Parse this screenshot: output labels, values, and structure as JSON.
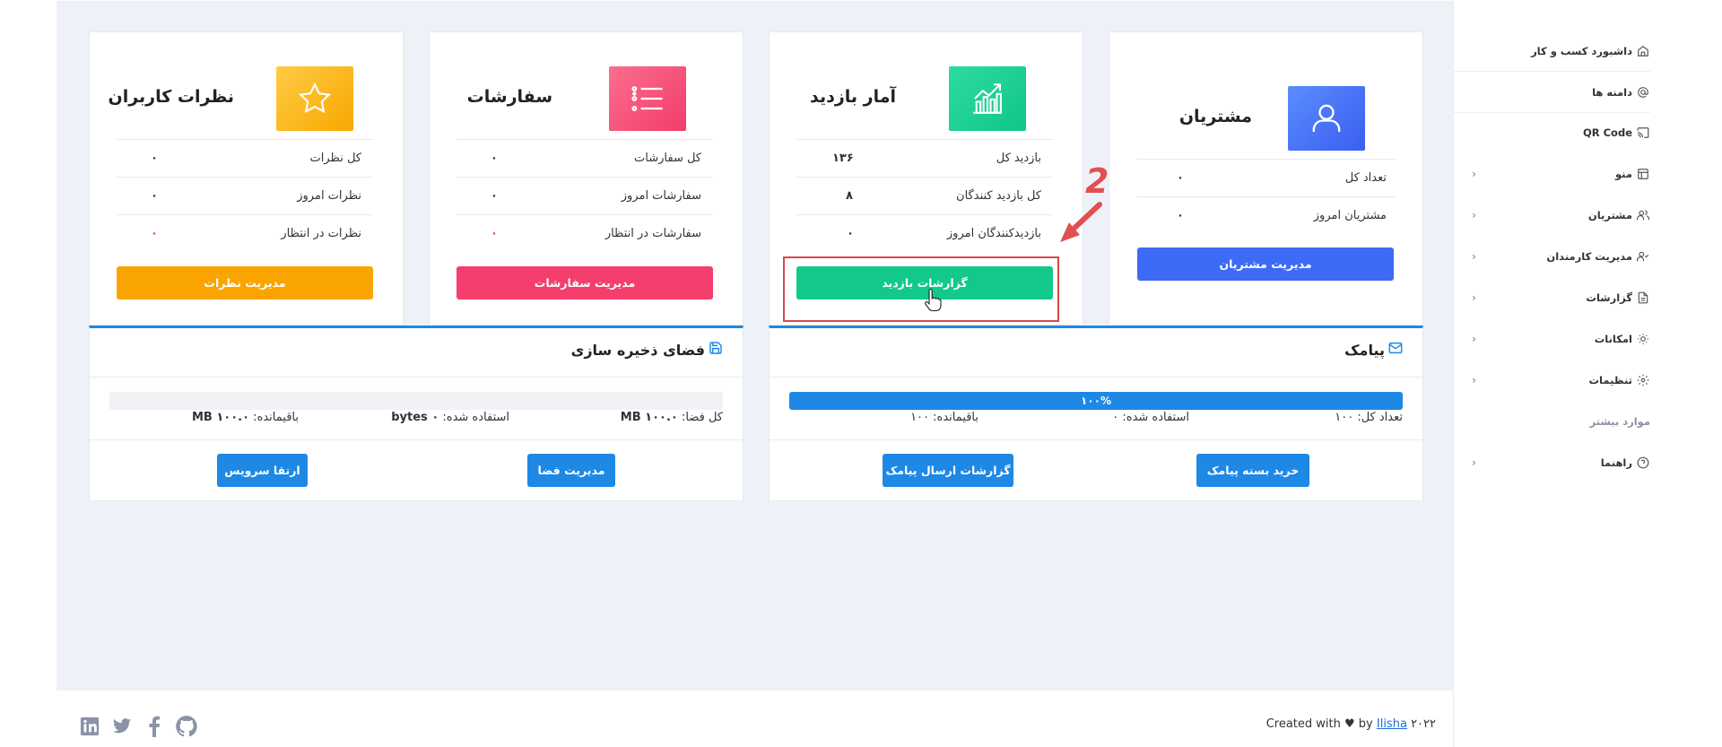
{
  "sidebar": {
    "items": [
      {
        "label": "داشبورد کسب و کار",
        "icon": "home-icon"
      },
      {
        "label": "دامنه ها",
        "icon": "at-icon"
      },
      {
        "label": "QR Code",
        "icon": "cast-icon"
      },
      {
        "label": "منو",
        "icon": "layout-icon"
      },
      {
        "label": "مشتریان",
        "icon": "users-icon"
      },
      {
        "label": "مدیریت کارمندان",
        "icon": "user-check-icon"
      },
      {
        "label": "گزارشات",
        "icon": "file-icon"
      },
      {
        "label": "امکانات",
        "icon": "sun-icon"
      },
      {
        "label": "تنظیمات",
        "icon": "gear-icon"
      }
    ],
    "more_label": "موارد بیشتر",
    "help": {
      "label": "راهنما",
      "icon": "help-icon"
    }
  },
  "cards": {
    "customers": {
      "title": "مشتریان",
      "rows": [
        {
          "label": "تعداد کل",
          "value": "۰"
        },
        {
          "label": "مشتریان امروز",
          "value": "۰"
        }
      ],
      "button": "مدیریت مشتریان",
      "color": "#3d6bf5"
    },
    "visits": {
      "title": "آمار بازدید",
      "rows": [
        {
          "label": "بازدید کل",
          "value": "۱۳۶"
        },
        {
          "label": "کل بازدید کنندگان",
          "value": "۸"
        },
        {
          "label": "بازدیدکنندگان امروز",
          "value": "۰"
        }
      ],
      "button": "گزارشات بازدید",
      "color": "#12c98a"
    },
    "orders": {
      "title": "سفارشات",
      "rows": [
        {
          "label": "کل سفارشات",
          "value": "۰"
        },
        {
          "label": "سفارشات امروز",
          "value": "۰"
        },
        {
          "label": "سفارشات در انتظار",
          "value": "۰"
        }
      ],
      "button": "مدیریت سفارشات",
      "color": "#f43f6e"
    },
    "reviews": {
      "title": "نظرات کاربران",
      "rows": [
        {
          "label": "کل نظرات",
          "value": "۰"
        },
        {
          "label": "نظرات امروز",
          "value": "۰"
        },
        {
          "label": "نظرات در انتظار",
          "value": "۰"
        }
      ],
      "button": "مدیریت نظرات",
      "color": "#f9a400"
    }
  },
  "sms": {
    "title": "پیامک",
    "progress_label": "۱۰۰%",
    "progress_fraction": 1.0,
    "total": "تعداد کل: ۱۰۰",
    "used": "استفاده شده: ۰",
    "remaining": "باقیمانده: ۱۰۰",
    "buttons": [
      "خرید بسته پیامک",
      "گزارشات ارسال پیامک"
    ]
  },
  "storage": {
    "title": "فضای ذخیره سازی",
    "progress_fraction": 0.0,
    "total_label": "کل فضا:",
    "total_value": "۱۰۰.۰ MB",
    "used_label": "استفاده شده:",
    "used_value": "۰ bytes",
    "remaining_label": "باقیمانده:",
    "remaining_value": "۱۰۰.۰ MB",
    "buttons": [
      "مدیریت فضا",
      "ارتقا سرویس"
    ]
  },
  "footer": {
    "prefix": "Created with ♥ by",
    "link": "Ilisha",
    "year": "۲۰۲۲"
  },
  "annotation": {
    "step": "2",
    "color": "#e05050"
  },
  "colors": {
    "primary": "#1e88e5",
    "background": "#eef1f8"
  }
}
